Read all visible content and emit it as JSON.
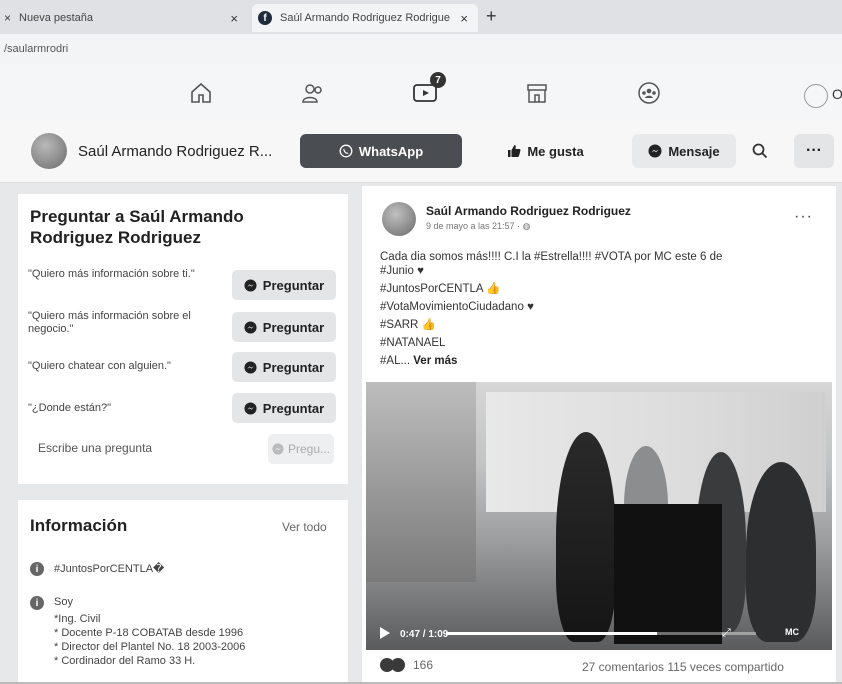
{
  "browser": {
    "tabs": [
      {
        "label": "Nueva pestaña",
        "close": "×"
      },
      {
        "label": "Saúl Armando Rodriguez Rodriguez",
        "close": "×"
      }
    ],
    "new_tab": "+",
    "url": "/saularmrodri",
    "favicon": "f"
  },
  "fbnav": {
    "items": [
      "home-icon",
      "friends-icon",
      "watch-icon",
      "marketplace-icon",
      "groups-icon"
    ],
    "watch_badge": "7",
    "profile_initial": "O"
  },
  "page_header": {
    "name": "Saúl Armando Rodriguez R...",
    "whatsapp_label": "WhatsApp",
    "like_label": "Me gusta",
    "message_label": "Mensaje",
    "more_label": "···"
  },
  "ask": {
    "title": "Preguntar a Saúl Armando Rodriguez Rodriguez",
    "questions": [
      {
        "text": "\"Quiero más información sobre ti.\"",
        "button": "Preguntar"
      },
      {
        "text": "\"Quiero más información sobre el negocio.\"",
        "button": "Preguntar"
      },
      {
        "text": "\"Quiero chatear con alguien.\"",
        "button": "Preguntar"
      },
      {
        "text": "\"¿Donde están?\"",
        "button": "Preguntar"
      }
    ],
    "input_placeholder": "Escribe una pregunta",
    "input_button": "Pregu..."
  },
  "info": {
    "title": "Información",
    "see_all": "Ver todo",
    "rows": [
      {
        "text": "#JuntosPorCENTLA�"
      },
      {
        "text": "Soy"
      }
    ],
    "details": [
      "*Ing. Civil",
      "* Docente P-18 COBATAB desde 1996",
      "* Director del Plantel No. 18 2003-2006",
      "* Cordinador del Ramo 33 H."
    ]
  },
  "post": {
    "author": "Saúl Armando Rodriguez Rodriguez",
    "time": "9 de mayo a las 21:57 · ",
    "more": "···",
    "lines": [
      "Cada dia somos más!!!! C.I la #Estrella!!!! #VOTA por MC este 6 de",
      "#Junio",
      "#JuntosPorCENTLA",
      "#VotaMovimientoCiudadano",
      "#SARR",
      "#NATANAEL",
      "#AL..."
    ],
    "see_more": "Ver más",
    "video": {
      "time": "0:47 / 1:09",
      "progress": 0.68,
      "logo_text": "MC"
    },
    "reactions_count": "166",
    "stats": "27 comentarios  115 veces compartido"
  }
}
